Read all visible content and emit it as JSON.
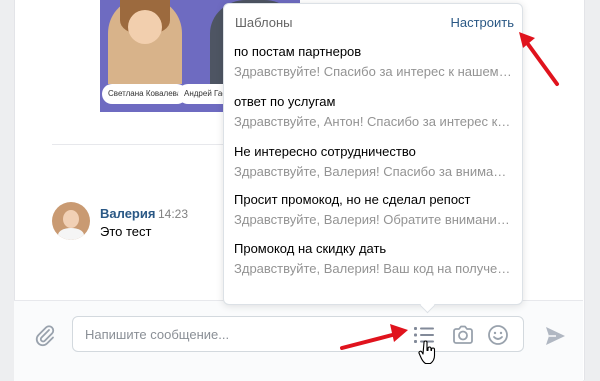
{
  "post": {
    "people": [
      {
        "name": "Светлана Ковалева"
      },
      {
        "name": "Андрей Гаев"
      }
    ]
  },
  "message": {
    "author": "Валерия",
    "time": "14:23",
    "text": "Это тест"
  },
  "composer": {
    "placeholder": "Напишите сообщение..."
  },
  "templates_popup": {
    "title": "Шаблоны",
    "settings_label": "Настроить",
    "items": [
      {
        "name": "по постам партнеров",
        "preview": "Здравствуйте! Спасибо за интерес к нашему предложению."
      },
      {
        "name": "ответ по услугам",
        "preview": "Здравствуйте, Антон! Спасибо за интерес к нашим услугам."
      },
      {
        "name": "Не интересно сотрудничество",
        "preview": "Здравствуйте, Валерия! Спасибо за внимание."
      },
      {
        "name": "Просит промокод, но не сделал репост",
        "preview": "Здравствуйте, Валерия! Обратите внимание на условия."
      },
      {
        "name": "Промокод на скидку дать",
        "preview": "Здравствуйте, Валерия! Ваш код на получение скидки."
      }
    ]
  },
  "icons": {
    "attach": "paperclip-icon",
    "templates": "list-icon",
    "camera": "camera-icon",
    "emoji": "smile-icon",
    "send": "send-icon",
    "cursor": "hand-pointer-icon"
  },
  "colors": {
    "accent": "#2a5885",
    "icon": "#99a2ad",
    "annotation": "#e0131d",
    "popup_border": "#dce1e6"
  }
}
